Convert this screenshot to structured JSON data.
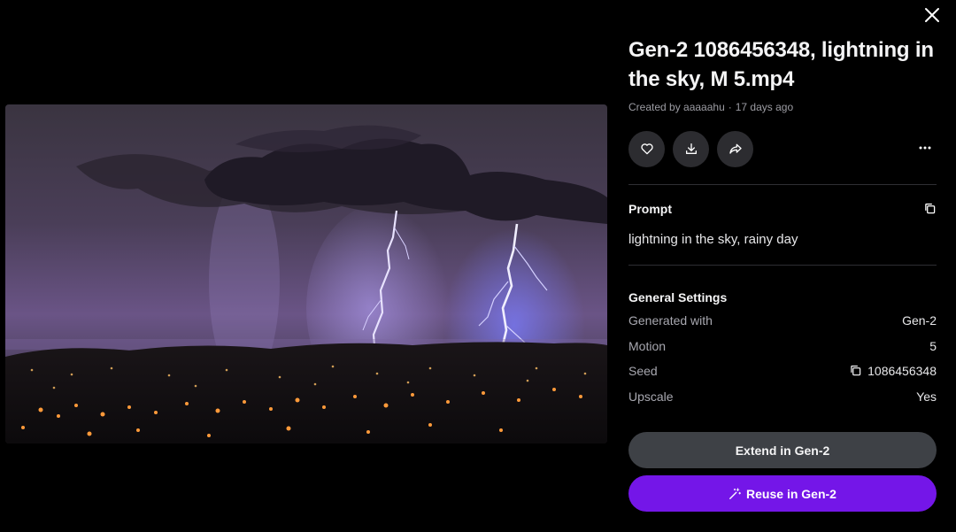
{
  "media": {
    "alt": "lightning in the sky, rainy day"
  },
  "header": {
    "title": "Gen-2 1086456348, lightning in the sky, M 5.mp4",
    "created_by": "Created by aaaaahu",
    "separator": "·",
    "age": "17 days ago"
  },
  "actions": {
    "like_icon": "heart-icon",
    "download_icon": "download-icon",
    "share_icon": "share-icon",
    "more_icon": "more-horizontal-icon"
  },
  "prompt": {
    "heading": "Prompt",
    "text": "lightning in the sky, rainy day",
    "copy_icon": "copy-icon"
  },
  "settings": {
    "heading": "General Settings",
    "rows": [
      {
        "label": "Generated with",
        "value": "Gen-2"
      },
      {
        "label": "Motion",
        "value": "5"
      },
      {
        "label": "Seed",
        "value": "1086456348"
      },
      {
        "label": "Upscale",
        "value": "Yes"
      }
    ]
  },
  "buttons": {
    "extend": "Extend in Gen-2",
    "reuse": "Reuse in Gen-2",
    "reuse_icon": "magic-wand-icon"
  },
  "colors": {
    "background": "#000000",
    "panel_button": "#2c2c30",
    "extend_button": "#3e4146",
    "accent": "#7416e8"
  }
}
